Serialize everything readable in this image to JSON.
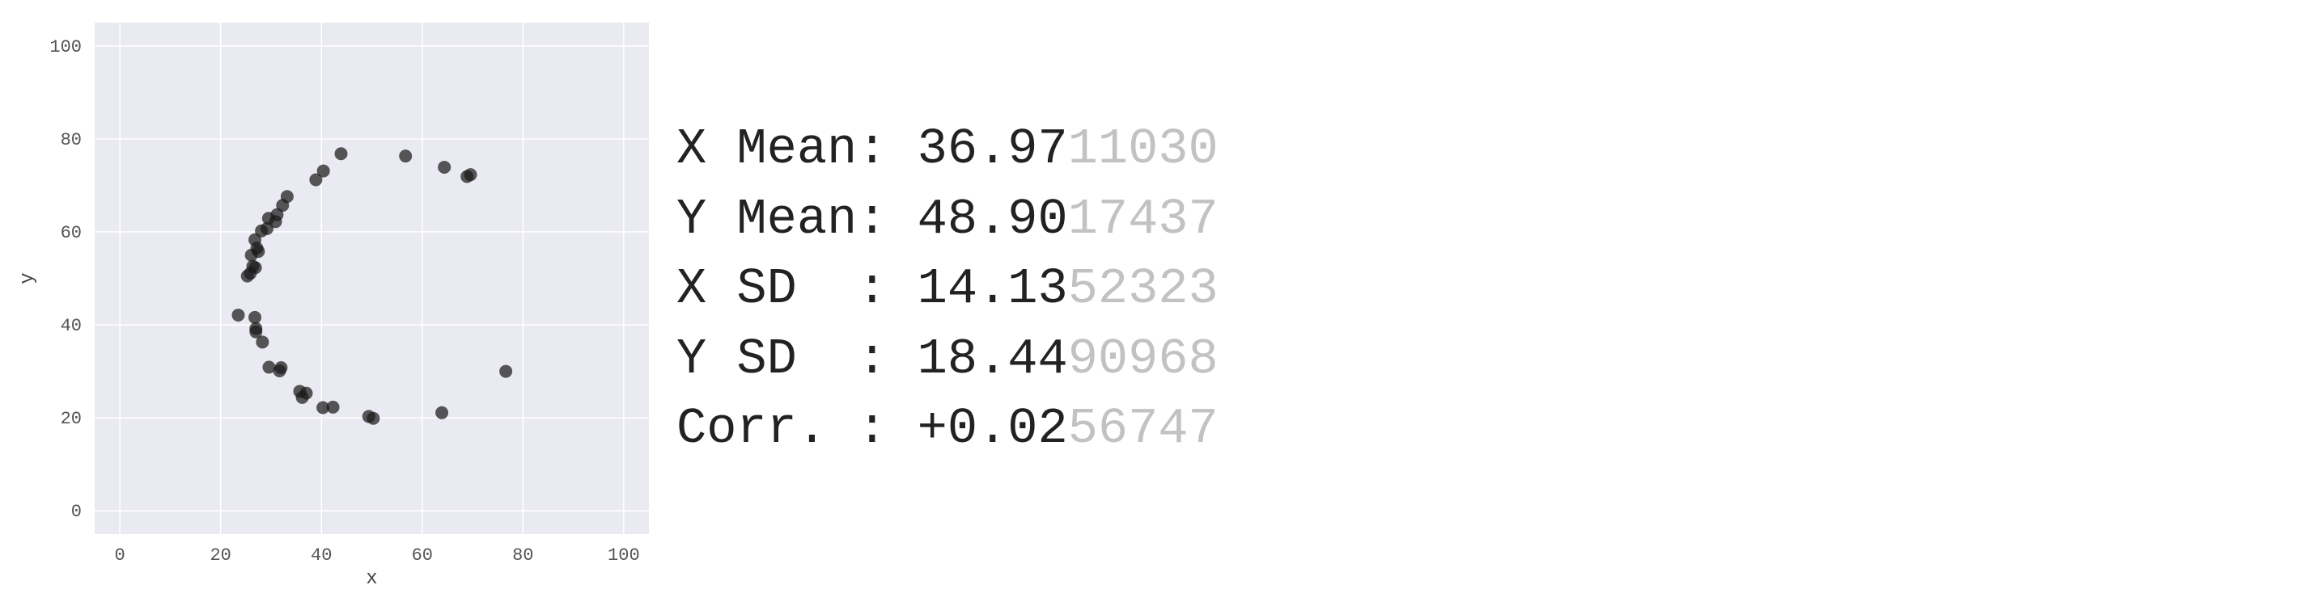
{
  "chart_data": {
    "type": "scatter",
    "title": "",
    "xlabel": "x",
    "ylabel": "y",
    "xlim": [
      -5,
      105
    ],
    "ylim": [
      -5,
      105
    ],
    "xticks": [
      0,
      20,
      40,
      60,
      80,
      100
    ],
    "yticks": [
      0,
      20,
      40,
      60,
      80,
      100
    ],
    "grid": true,
    "background_color": "#eaeaf2",
    "point_color": "#1a1a1a",
    "points": [
      [
        25.3,
        50.5
      ],
      [
        25.9,
        51.1
      ],
      [
        26.4,
        52.6
      ],
      [
        26.9,
        52.3
      ],
      [
        26.1,
        55.0
      ],
      [
        27.2,
        56.5
      ],
      [
        27.5,
        55.8
      ],
      [
        26.8,
        58.3
      ],
      [
        28.1,
        60.2
      ],
      [
        29.2,
        60.7
      ],
      [
        29.5,
        62.9
      ],
      [
        30.9,
        62.2
      ],
      [
        31.2,
        63.7
      ],
      [
        32.3,
        65.7
      ],
      [
        33.2,
        67.6
      ],
      [
        38.9,
        71.2
      ],
      [
        40.4,
        73.1
      ],
      [
        43.9,
        76.8
      ],
      [
        56.7,
        76.3
      ],
      [
        64.4,
        73.9
      ],
      [
        68.9,
        71.9
      ],
      [
        69.6,
        72.3
      ],
      [
        23.5,
        42.1
      ],
      [
        26.8,
        41.6
      ],
      [
        27.0,
        39.2
      ],
      [
        27.0,
        38.5
      ],
      [
        28.3,
        36.3
      ],
      [
        29.6,
        30.9
      ],
      [
        31.7,
        30.1
      ],
      [
        32.0,
        30.8
      ],
      [
        35.7,
        25.7
      ],
      [
        36.2,
        24.4
      ],
      [
        37.0,
        25.3
      ],
      [
        40.3,
        22.2
      ],
      [
        42.3,
        22.3
      ],
      [
        49.4,
        20.3
      ],
      [
        50.3,
        19.9
      ],
      [
        63.9,
        21.1
      ],
      [
        76.6,
        30.0
      ]
    ]
  },
  "stats": [
    {
      "label": "X Mean: ",
      "value_main": "36.97",
      "value_faded": "11030"
    },
    {
      "label": "Y Mean: ",
      "value_main": "48.90",
      "value_faded": "17437"
    },
    {
      "label": "X SD  : ",
      "value_main": "14.13",
      "value_faded": "52323"
    },
    {
      "label": "Y SD  : ",
      "value_main": "18.44",
      "value_faded": "90968"
    },
    {
      "label": "Corr. : ",
      "value_main": "+0.02",
      "value_faded": "56747"
    }
  ]
}
